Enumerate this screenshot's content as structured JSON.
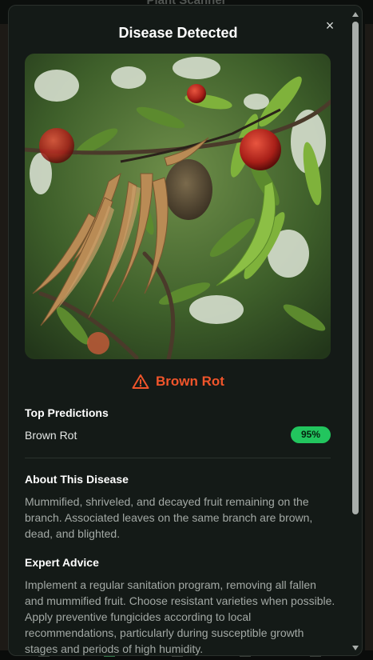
{
  "background": {
    "app_title": "Plant Scanner"
  },
  "modal": {
    "title": "Disease Detected",
    "close_symbol": "×",
    "image": {
      "alt": "Peach branch with dead brown leaves and a mummified fruit"
    },
    "disease": {
      "name": "Brown Rot",
      "icon": "warning-triangle-icon",
      "color": "#f0552b"
    },
    "top_predictions": {
      "heading": "Top Predictions",
      "items": [
        {
          "label": "Brown Rot",
          "confidence": "95%",
          "badge_color": "#22c55e"
        }
      ]
    },
    "about": {
      "heading": "About This Disease",
      "text": "Mummified, shriveled, and decayed fruit remaining on the branch. Associated leaves on the same branch are brown, dead, and blighted."
    },
    "advice": {
      "heading": "Expert Advice",
      "text": "Implement a regular sanitation program, removing all fallen and mummified fruit. Choose resistant varieties when possible. Apply preventive fungicides according to local recommendations, particularly during susceptible growth stages and periods of high humidity."
    }
  }
}
